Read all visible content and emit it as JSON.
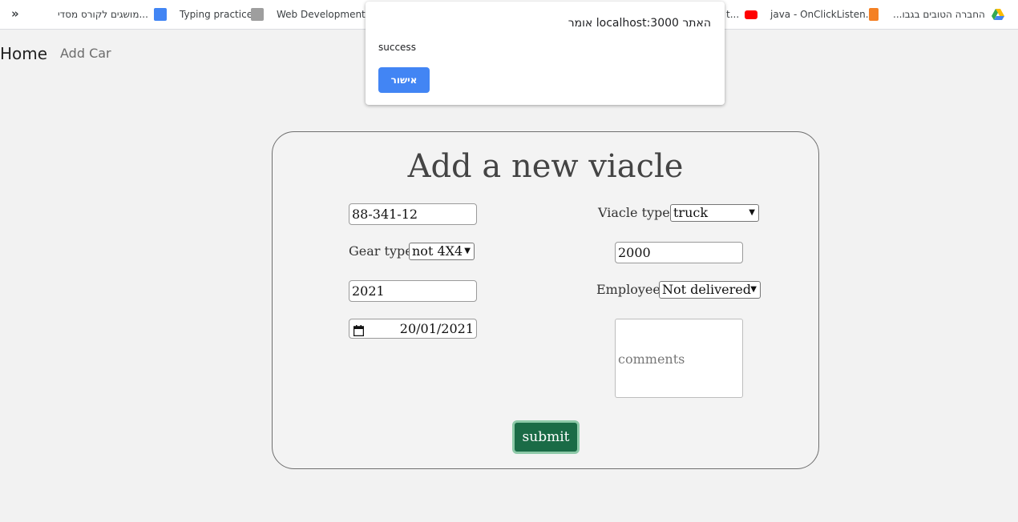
{
  "bookmarks": {
    "overflow_label": "»",
    "items": [
      {
        "label": "מושגים לקורס מסדי...",
        "icon": "google-docs-icon"
      },
      {
        "label": "Typing practice",
        "icon": "typing-site-icon"
      },
      {
        "label": "Web Development...",
        "icon": "web-dev-icon"
      },
      {
        "label": "t...",
        "icon": ""
      },
      {
        "label": "java - OnClickListen...",
        "icon": "youtube-icon"
      },
      {
        "label": "...החברה הטובים בגבו",
        "icon": "stackoverflow-icon"
      },
      {
        "label": "",
        "icon": "google-drive-icon"
      }
    ]
  },
  "nav": {
    "home": "Home",
    "add_car": "Add Car"
  },
  "dialog": {
    "title": "האתר localhost:3000 אומר",
    "message": "success",
    "ok_label": "אישור"
  },
  "form": {
    "title": "Add a new viacle",
    "plate_value": "88-341-12",
    "viacle_type_label": "Viacle type:",
    "viacle_type_value": "truck",
    "gear_type_label": "Gear type",
    "gear_type_value": "not 4X4",
    "engine_value": "2000",
    "year_value": "2021",
    "employee_label": "Employee",
    "employee_value": "Not delivered",
    "date_value": "20/01/2021",
    "comments_placeholder": "comments",
    "submit_label": "submit"
  },
  "colors": {
    "page_bg": "#f2f2f2",
    "dialog_button": "#4285f4",
    "submit_bg": "#1a6b46",
    "submit_border": "#8dc9a8"
  }
}
